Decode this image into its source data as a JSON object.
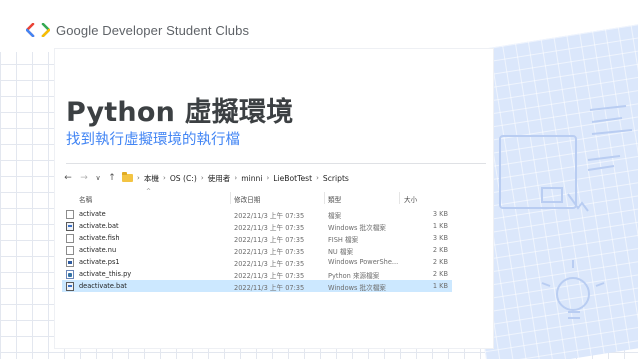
{
  "brand": {
    "text": "Google Developer Student Clubs",
    "colors": [
      "#4285f4",
      "#ea4335",
      "#34a853"
    ]
  },
  "slide": {
    "title": "Python 虛擬環境",
    "subtitle": "找到執行虛擬環境的執行檔",
    "accent": "#4285f4"
  },
  "explorer": {
    "nav": {
      "back": "←",
      "forward": "→",
      "dropdown": "∨",
      "up": "↑"
    },
    "breadcrumb": [
      "本機",
      "OS (C:)",
      "使用者",
      "minni",
      "LieBotTest",
      "Scripts"
    ],
    "columns": {
      "name": "名稱",
      "date": "修改日期",
      "type": "類型",
      "size": "大小"
    },
    "files": [
      {
        "name": "activate",
        "date": "2022/11/3 上午 07:35",
        "type": "檔案",
        "size": "3 KB",
        "icon": "file-icon"
      },
      {
        "name": "activate.bat",
        "date": "2022/11/3 上午 07:35",
        "type": "Windows 批次檔案",
        "size": "1 KB",
        "icon": "batch-file-icon"
      },
      {
        "name": "activate.fish",
        "date": "2022/11/3 上午 07:35",
        "type": "FISH 檔案",
        "size": "3 KB",
        "icon": "file-icon"
      },
      {
        "name": "activate.nu",
        "date": "2022/11/3 上午 07:35",
        "type": "NU 檔案",
        "size": "2 KB",
        "icon": "file-icon"
      },
      {
        "name": "activate.ps1",
        "date": "2022/11/3 上午 07:35",
        "type": "Windows PowerShe...",
        "size": "2 KB",
        "icon": "powershell-file-icon"
      },
      {
        "name": "activate_this.py",
        "date": "2022/11/3 上午 07:35",
        "type": "Python 來源檔案",
        "size": "2 KB",
        "icon": "python-file-icon"
      },
      {
        "name": "deactivate.bat",
        "date": "2022/11/3 上午 07:35",
        "type": "Windows 批次檔案",
        "size": "1 KB",
        "icon": "batch-file-icon",
        "selected": true
      }
    ]
  }
}
